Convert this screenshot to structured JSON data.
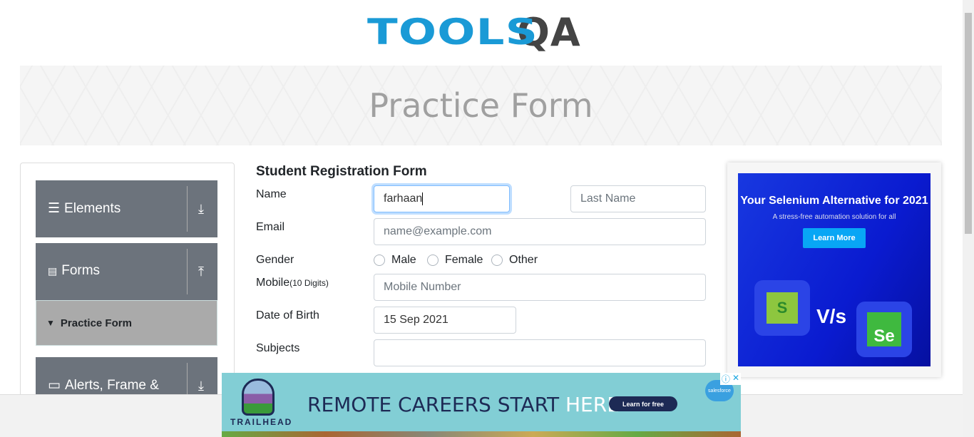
{
  "logo": {
    "tools": "TOOLS",
    "qa": "QA"
  },
  "page_title": "Practice Form",
  "sidebar": {
    "groups": [
      {
        "label": "Elements",
        "icon": "hamburger-icon"
      },
      {
        "label": "Forms",
        "icon": "document-icon"
      },
      {
        "label": "Alerts, Frame &",
        "icon": "window-icon"
      }
    ],
    "active_item": "Practice Form"
  },
  "form": {
    "title": "Student Registration Form",
    "name_label": "Name",
    "first_name": "farhaan",
    "last_name_placeholder": "Last Name",
    "email_label": "Email",
    "email_placeholder": "name@example.com",
    "gender_label": "Gender",
    "genders": [
      "Male",
      "Female",
      "Other"
    ],
    "mobile_label": "Mobile",
    "mobile_hint": "(10 Digits)",
    "mobile_placeholder": "Mobile Number",
    "dob_label": "Date of Birth",
    "dob": "15 Sep 2021",
    "subjects_label": "Subjects",
    "subjects": ""
  },
  "right_ad": {
    "title": "Your Selenium Alternative for 2021",
    "subtitle": "A stress-free automation solution for all",
    "button": "Learn More",
    "vs": "V/s",
    "left_logo": "S",
    "right_logo": "Se"
  },
  "bottom_ad": {
    "brand": "TRAILHEAD",
    "headline": "REMOTE CAREERS START ",
    "headline_accent": "HERE.",
    "button": "Learn for free",
    "sponsor": "salesforce",
    "info": "ⓘ",
    "close": "✕"
  }
}
